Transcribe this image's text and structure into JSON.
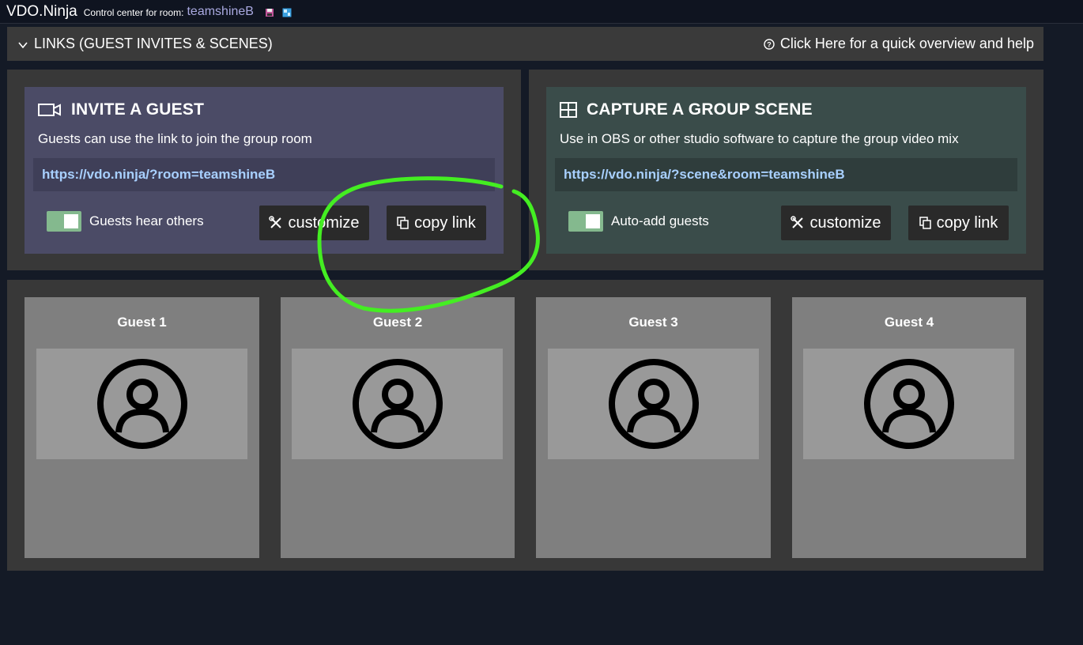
{
  "topbar": {
    "brand": "VDO.Ninja",
    "room_caption": "Control center for room:",
    "room_name": "teamshineB",
    "icons": [
      "save-icon",
      "window-icon"
    ]
  },
  "links_bar": {
    "toggle_label": "LINKS (GUEST INVITES & SCENES)",
    "help_label": "Click Here for a quick overview and help",
    "toggle_icon": "triangle-down-icon",
    "help_icon": "question-circle-icon"
  },
  "invite": {
    "title": "INVITE A GUEST",
    "icon": "video-camera-icon",
    "description": "Guests can use the link to join the group room",
    "link": "https://vdo.ninja/?room=teamshineB",
    "toggle_label": "Guests hear others",
    "toggle_on": true,
    "customize_label": "customize",
    "copy_label": "copy link"
  },
  "scene": {
    "title": "CAPTURE A GROUP SCENE",
    "icon": "grid-icon",
    "description": "Use in OBS or other studio software to capture the group video mix",
    "link": "https://vdo.ninja/?scene&room=teamshineB",
    "toggle_label": "Auto-add guests",
    "toggle_on": true,
    "customize_label": "customize",
    "copy_label": "copy link"
  },
  "guests": [
    {
      "label": "Guest 1"
    },
    {
      "label": "Guest 2"
    },
    {
      "label": "Guest 3"
    },
    {
      "label": "Guest 4"
    }
  ],
  "colors": {
    "invite_card": "#4b4b66",
    "scene_card": "#3a4c4a",
    "annotation": "#44ee22"
  }
}
